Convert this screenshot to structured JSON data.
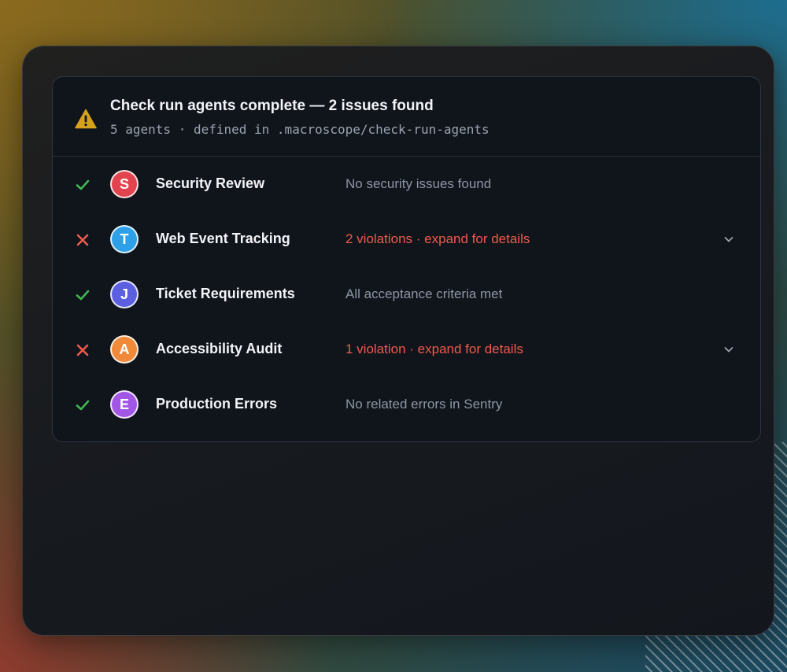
{
  "header": {
    "title": "Check run agents complete — 2 issues found",
    "subtitle": "5 agents · defined in .macroscope/check-run-agents",
    "icon": "warning-triangle-icon"
  },
  "colors": {
    "pass": "#3fb950",
    "fail": "#ef5b4c",
    "warning": "#d6a21d"
  },
  "agents": [
    {
      "status": "pass",
      "initial": "S",
      "name": "Security Review",
      "detail": "No security issues found",
      "avatar_color": "#e2434e",
      "expandable": false
    },
    {
      "status": "fail",
      "initial": "T",
      "name": "Web Event Tracking",
      "detail": "2 violations · expand for details",
      "avatar_color": "#2ea0e8",
      "expandable": true
    },
    {
      "status": "pass",
      "initial": "J",
      "name": "Ticket Requirements",
      "detail": "All acceptance criteria met",
      "avatar_color": "#5b5fe0",
      "expandable": false
    },
    {
      "status": "fail",
      "initial": "A",
      "name": "Accessibility Audit",
      "detail": "1 violation · expand for details",
      "avatar_color": "#f08a3a",
      "expandable": true
    },
    {
      "status": "pass",
      "initial": "E",
      "name": "Production Errors",
      "detail": "No related errors in Sentry",
      "avatar_color": "#a256e6",
      "expandable": false
    }
  ]
}
